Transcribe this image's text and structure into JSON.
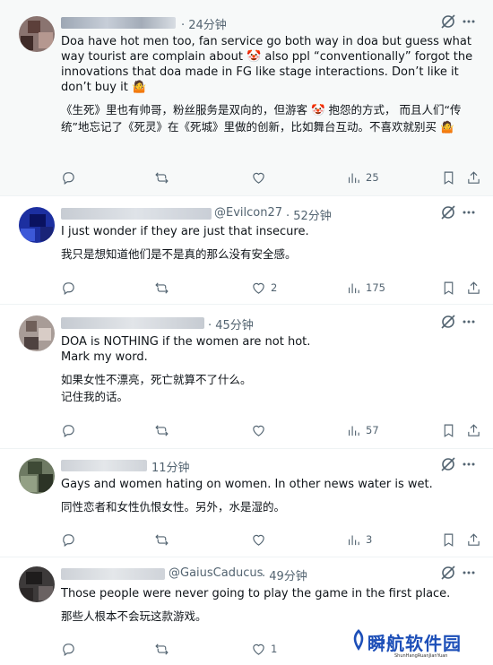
{
  "posts": [
    {
      "handle": "",
      "time": "· 24分钟",
      "text_en": "Doa have hot men too, fan service go both way in doa but guess what way tourist are complain about 🤡 also ppl “conventionally” forgot the innovations that doa made in FG like stage interactions. Don’t like it don’t buy it 🤷",
      "text_zh": "《生死》里也有帅哥，粉丝服务是双向的，但游客 🤡 抱怨的方式， 而且人们“传统”地忘记了《死灵》在《死城》里做的创新，比如舞台互动。不喜欢就别买 🤷",
      "replies": "",
      "reposts": "",
      "likes": "",
      "views": "25"
    },
    {
      "handle": "@Evilcon27",
      "time": "· 52分钟",
      "text_en": "I just wonder if they are just that insecure.",
      "text_zh": "我只是想知道他们是不是真的那么没有安全感。",
      "replies": "",
      "reposts": "",
      "likes": "2",
      "views": "175"
    },
    {
      "handle": "",
      "time": "· 45分钟",
      "text_en_1": "DOA is NOTHING if the women are not hot.",
      "text_en_2": "Mark my word.",
      "text_zh_1": "如果女性不漂亮，死亡就算不了什么。",
      "text_zh_2": "记住我的话。",
      "replies": "",
      "reposts": "",
      "likes": "",
      "views": "57"
    },
    {
      "handle": "",
      "time": "11分钟",
      "text_en": "Gays and women hating on women. In other news water is wet.",
      "text_zh": "同性恋者和女性仇恨女性。另外，水是湿的。",
      "replies": "",
      "reposts": "",
      "likes": "",
      "views": "3"
    },
    {
      "handle": "@GaiusCaducus",
      "time": "· 49分钟",
      "text_en": "Those people were never going to play the game in the first place.",
      "text_zh": "那些人根本不会玩这款游戏。",
      "replies": "",
      "reposts": "",
      "likes": "1",
      "views": ""
    }
  ],
  "watermark": {
    "title": "瞬航软件园",
    "subtitle": "ShunHangRuanJianYuan"
  },
  "icons": {
    "reply": "reply-icon",
    "repost": "repost-icon",
    "like": "like-icon",
    "views": "views-icon",
    "bookmark": "bookmark-icon",
    "share": "share-icon",
    "grok": "grok-icon"
  },
  "colors": {
    "text": "#0f1419",
    "muted": "#536471",
    "divider": "#eff3f4",
    "highlight_bg": "#f7f9f9",
    "watermark": "#1d4fb8"
  }
}
